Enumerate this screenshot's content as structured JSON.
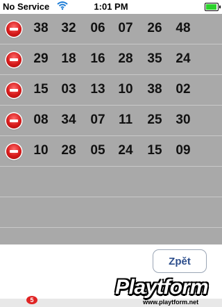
{
  "status_bar": {
    "carrier": "No Service",
    "time": "1:01 PM",
    "wifi_icon": "wifi-icon",
    "battery_icon": "battery-icon",
    "battery_level": 0.95,
    "battery_color": "#2bd22b"
  },
  "rows": [
    [
      "38",
      "32",
      "06",
      "07",
      "26",
      "48"
    ],
    [
      "29",
      "18",
      "16",
      "28",
      "35",
      "24"
    ],
    [
      "15",
      "03",
      "13",
      "10",
      "38",
      "02"
    ],
    [
      "08",
      "34",
      "07",
      "11",
      "25",
      "30"
    ],
    [
      "10",
      "28",
      "05",
      "24",
      "15",
      "09"
    ]
  ],
  "delete_icon": "minus-circle-icon",
  "back_button": {
    "label": "Zpět"
  },
  "dock": {
    "badge": "5"
  },
  "watermark": {
    "brand": "Playtform",
    "url": "www.playtform.net"
  },
  "colors": {
    "table_background": "#a9a9a9",
    "delete_red": "#d61a1a",
    "button_text": "#2d4e8c"
  }
}
